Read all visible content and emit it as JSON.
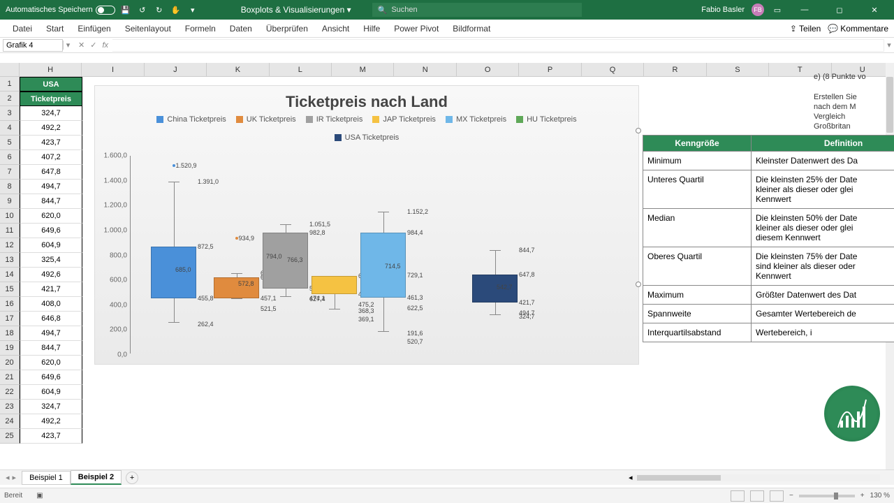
{
  "titlebar": {
    "autosave_label": "Automatisches Speichern",
    "doc_name": "Boxplots & Visualisierungen",
    "search_placeholder": "Suchen",
    "user_name": "Fabio Basler",
    "user_initials": "FB"
  },
  "ribbon": {
    "tabs": [
      "Datei",
      "Start",
      "Einfügen",
      "Seitenlayout",
      "Formeln",
      "Daten",
      "Überprüfen",
      "Ansicht",
      "Hilfe",
      "Power Pivot",
      "Bildformat"
    ],
    "share": "Teilen",
    "comments": "Kommentare"
  },
  "formula": {
    "name_box": "Grafik 4",
    "fx": "fx",
    "value": ""
  },
  "columns": [
    "H",
    "I",
    "J",
    "K",
    "L",
    "M",
    "N",
    "O",
    "P",
    "Q",
    "R",
    "S",
    "T",
    "U"
  ],
  "data_col": {
    "header1": "USA",
    "header2": "Ticketpreis",
    "values": [
      "324,7",
      "492,2",
      "423,7",
      "407,2",
      "647,8",
      "494,7",
      "844,7",
      "620,0",
      "649,6",
      "604,9",
      "325,4",
      "492,6",
      "421,7",
      "408,0",
      "646,8",
      "494,7",
      "844,7",
      "620,0",
      "649,6",
      "604,9",
      "324,7",
      "492,2",
      "423,7"
    ]
  },
  "notes": {
    "e": "e)   (8 Punkte vo",
    "l1": "Erstellen Sie",
    "l2": "nach dem M",
    "l3": "Vergleich",
    "l4": "Großbritan"
  },
  "side_table": {
    "h1": "Kenngröße",
    "h2": "Definition",
    "rows": [
      {
        "k": "Minimum",
        "d": "Kleinster Datenwert des Da"
      },
      {
        "k": "Unteres Quartil",
        "d": "Die kleinsten 25% der Date\nkleiner als dieser oder glei\nKennwert"
      },
      {
        "k": "Median",
        "d": "Die kleinsten 50% der Date\nkleiner als dieser oder glei\ndiesem Kennwert"
      },
      {
        "k": "Oberes Quartil",
        "d": "Die kleinsten 75% der Date\nsind kleiner als dieser oder\nKennwert"
      },
      {
        "k": "Maximum",
        "d": "Größter Datenwert des Dat"
      },
      {
        "k": "Spannweite",
        "d": "Gesamter Wertebereich de"
      },
      {
        "k": "Interquartilsabstand",
        "d": "Wertebereich, i"
      }
    ]
  },
  "sheets": {
    "s1": "Beispiel 1",
    "s2": "Beispiel 2"
  },
  "status": {
    "ready": "Bereit",
    "zoom": "130 %"
  },
  "chart_data": {
    "type": "boxplot",
    "title": "Ticketpreis nach Land",
    "ylabel": "",
    "ylim": [
      0,
      1600
    ],
    "yticks": [
      "0,0",
      "200,0",
      "400,0",
      "600,0",
      "800,0",
      "1.000,0",
      "1.200,0",
      "1.400,0",
      "1.600,0"
    ],
    "legend": [
      {
        "name": "China Ticketpreis",
        "color": "#4a90d9"
      },
      {
        "name": "UK Ticketpreis",
        "color": "#e08b3e"
      },
      {
        "name": "IR Ticketpreis",
        "color": "#a0a0a0"
      },
      {
        "name": "JAP Ticketpreis",
        "color": "#f5c242"
      },
      {
        "name": "MX Ticketpreis",
        "color": "#6fb7e8"
      },
      {
        "name": "HU Ticketpreis",
        "color": "#5fa858"
      },
      {
        "name": "USA Ticketpreis",
        "color": "#2b4a7a"
      }
    ],
    "series": [
      {
        "name": "China",
        "min": 262.4,
        "q1": 455.8,
        "median": 685.0,
        "q3": 872.5,
        "max": 1391.0,
        "outliers": [
          1520.9
        ],
        "labels": {
          "outlier": "1.520,9",
          "max": "1.391,0",
          "q3": "872,5",
          "median": "685,0",
          "q1": "455,8",
          "min": "262,4"
        }
      },
      {
        "name": "UK",
        "min": 457.1,
        "q1": 457.1,
        "median": 572.8,
        "q3": 623.3,
        "max": 656.6,
        "outliers": [
          934.9
        ],
        "labels": {
          "outlier": "934,9",
          "max": "656,6",
          "q3": "623,3",
          "median": "572,8",
          "q1": "457,1",
          "extra": "521,5"
        }
      },
      {
        "name": "IR",
        "min": 474.1,
        "q1": 533.3,
        "median": 766.3,
        "mean": 794.0,
        "q3": 982.8,
        "max": 1051.5,
        "labels": {
          "max": "1.051,5",
          "q3": "982,8",
          "mean": "794,0",
          "median": "766,3",
          "q1": "533,3",
          "min": "474,1",
          "extra": "627,4"
        }
      },
      {
        "name": "JAP",
        "min": 368.3,
        "q1": 488.3,
        "median": 636.8,
        "q3": 636.8,
        "max": 636.8,
        "labels": {
          "max": "636,8",
          "q1": "488,3",
          "min": "368,3",
          "extra": "475,2",
          "extra2": "369,1"
        }
      },
      {
        "name": "MX",
        "min": 191.6,
        "q1": 461.3,
        "median": 714.5,
        "q3": 984.4,
        "max": 1152.2,
        "labels": {
          "max": "1.152,2",
          "q3": "984,4",
          "median": "714,5",
          "q1": "461,3",
          "min": "191,6",
          "extra": "622,5",
          "extra2": "520,7",
          "extra3": "729,1"
        }
      },
      {
        "name": "HU",
        "labels": {}
      },
      {
        "name": "USA",
        "min": 324.7,
        "q1": 421.7,
        "median": 542.7,
        "q3": 647.8,
        "max": 844.7,
        "labels": {
          "max": "844,7",
          "q3": "647,8",
          "median": "542,7",
          "q1": "421,7",
          "min": "324,7",
          "extra": "494,7"
        }
      }
    ]
  }
}
